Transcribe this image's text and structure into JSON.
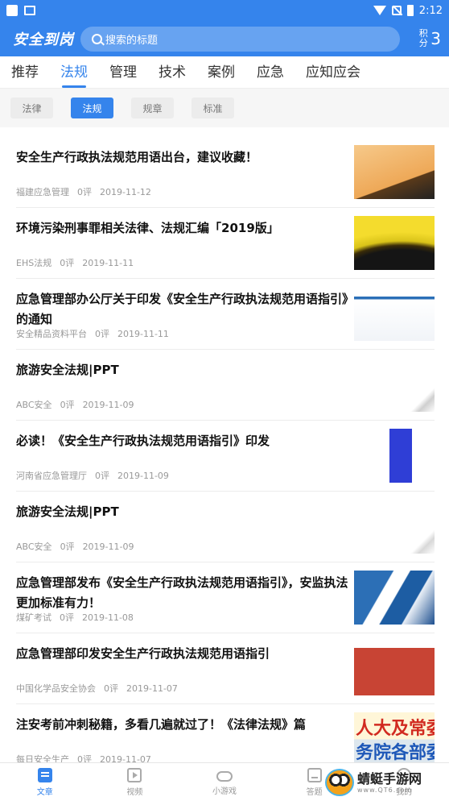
{
  "status_bar": {
    "time": "2:12"
  },
  "header": {
    "logo": "安全到岗",
    "search_placeholder": "搜索的标题",
    "points_label": "积分",
    "points_value": "3"
  },
  "tabs": [
    "推荐",
    "法规",
    "管理",
    "技术",
    "案例",
    "应急",
    "应知应会"
  ],
  "active_tab": "法规",
  "chips": [
    "法律",
    "法规",
    "规章",
    "标准"
  ],
  "active_chip": "法规",
  "articles": [
    {
      "title": "安全生产行政执法规范用语出台，建议收藏！",
      "source": "福建应急管理",
      "comments": "0评",
      "date": "2019-11-12"
    },
    {
      "title": "环境污染刑事罪相关法律、法规汇编「2019版」",
      "source": "EHS法规",
      "comments": "0评",
      "date": "2019-11-11"
    },
    {
      "title": "应急管理部办公厅关于印发《安全生产行政执法规范用语指引》的通知",
      "source": "安全精品资料平台",
      "comments": "0评",
      "date": "2019-11-11"
    },
    {
      "title": "旅游安全法规|PPT",
      "source": "ABC安全",
      "comments": "0评",
      "date": "2019-11-09"
    },
    {
      "title": "必读！《安全生产行政执法规范用语指引》印发",
      "source": "河南省应急管理厅",
      "comments": "0评",
      "date": "2019-11-09"
    },
    {
      "title": "旅游安全法规|PPT",
      "source": "ABC安全",
      "comments": "0评",
      "date": "2019-11-09"
    },
    {
      "title": "应急管理部发布《安全生产行政执法规范用语指引》，安监执法更加标准有力！",
      "source": "煤矿考试",
      "comments": "0评",
      "date": "2019-11-08"
    },
    {
      "title": "应急管理部印发安全生产行政执法规范用语指引",
      "source": "中国化学品安全协会",
      "comments": "0评",
      "date": "2019-11-07"
    },
    {
      "title": "注安考前冲刺秘籍，多看几遍就过了！《法律法规》篇",
      "source": "每日安全生产",
      "comments": "0评",
      "date": "2019-11-07"
    }
  ],
  "thumb9_text": [
    "人大及常委",
    "务院各部委"
  ],
  "bottom_nav": [
    {
      "label": "文章",
      "icon": "article-icon"
    },
    {
      "label": "视频",
      "icon": "video-icon"
    },
    {
      "label": "小游戏",
      "icon": "gamepad-icon"
    },
    {
      "label": "答题",
      "icon": "quiz-icon"
    },
    {
      "label": "我的",
      "icon": "user-icon"
    }
  ],
  "watermark": {
    "title": "蜻蜓手游网",
    "url": "www.QT6.com"
  },
  "colors": {
    "primary": "#3584ec"
  }
}
